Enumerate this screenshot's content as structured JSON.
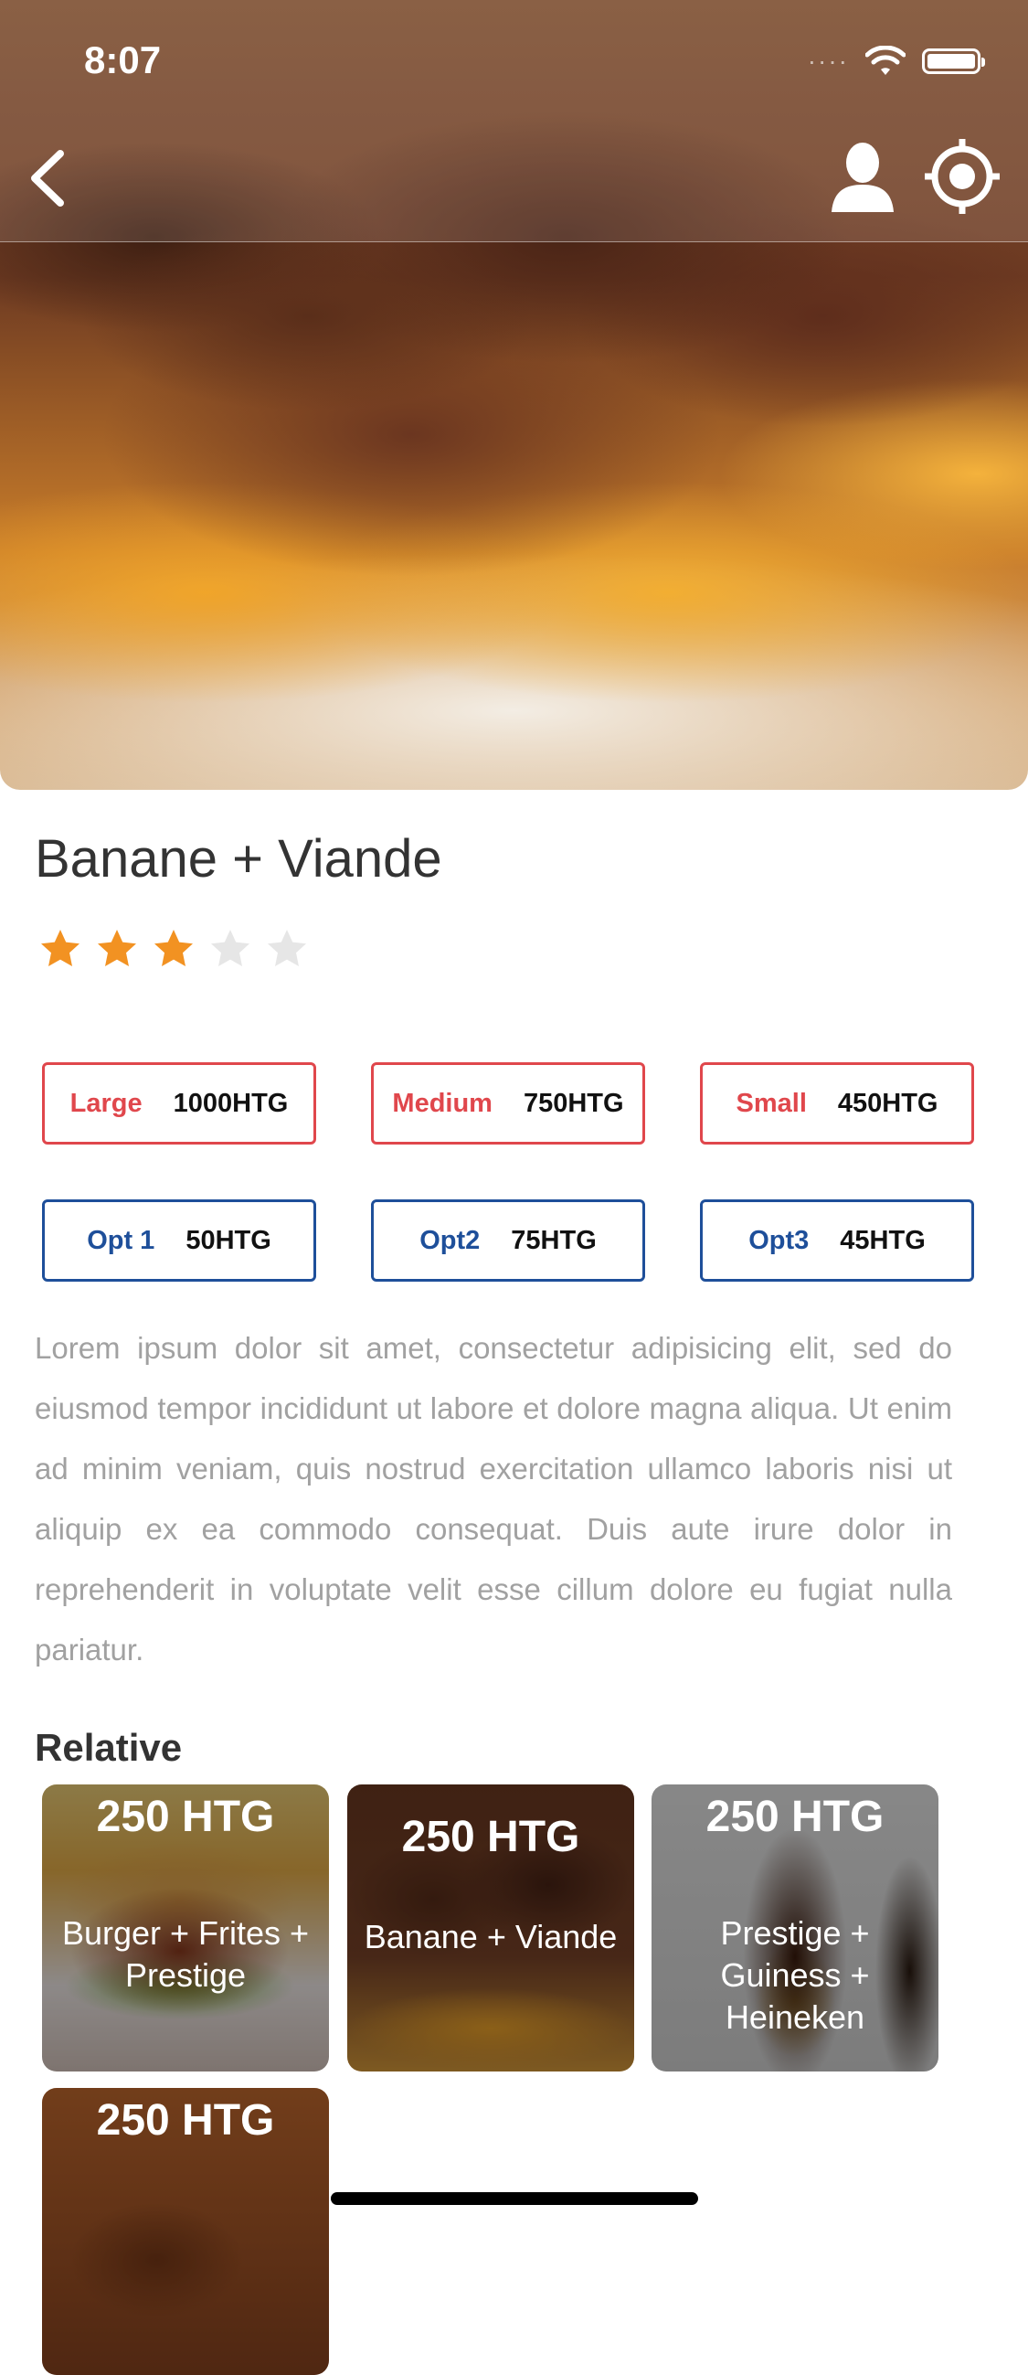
{
  "status_bar": {
    "time": "8:07"
  },
  "product": {
    "title": "Banane + Viande",
    "rating": 3,
    "rating_max": 5,
    "star_color_on": "#f29222",
    "star_color_off": "#e6e6e6"
  },
  "sizes": [
    {
      "label": "Large",
      "price": "1000HTG"
    },
    {
      "label": "Medium",
      "price": "750HTG"
    },
    {
      "label": "Small",
      "price": "450HTG"
    }
  ],
  "options": [
    {
      "label": "Opt 1",
      "price": "50HTG"
    },
    {
      "label": "Opt2",
      "price": "75HTG"
    },
    {
      "label": "Opt3",
      "price": "45HTG"
    }
  ],
  "description": "Lorem ipsum dolor sit amet, consectetur adipisicing elit, sed do eiusmod tempor incididunt ut labore et dolore magna aliqua. Ut enim ad minim veniam, quis nostrud exercitation ullamco laboris nisi ut aliquip ex ea commodo consequat. Duis aute irure dolor in reprehenderit in voluptate velit esse cillum dolore eu fugiat nulla pariatur.",
  "relative": {
    "heading": "Relative",
    "items": [
      {
        "price": "250 HTG",
        "name": "Burger + Frites + Prestige"
      },
      {
        "price": "250 HTG",
        "name": "Banane + Viande"
      },
      {
        "price": "250 HTG",
        "name": "Prestige + Guiness + Heineken"
      },
      {
        "price": "250 HTG",
        "name": ""
      }
    ]
  },
  "colors": {
    "size_accent": "#e0474c",
    "option_accent": "#1e4f9a",
    "description_text": "#a1a1a1"
  },
  "icons": {
    "back": "chevron-left-icon",
    "profile": "user-icon",
    "location": "target-icon",
    "wifi": "wifi-icon",
    "battery": "battery-icon"
  }
}
